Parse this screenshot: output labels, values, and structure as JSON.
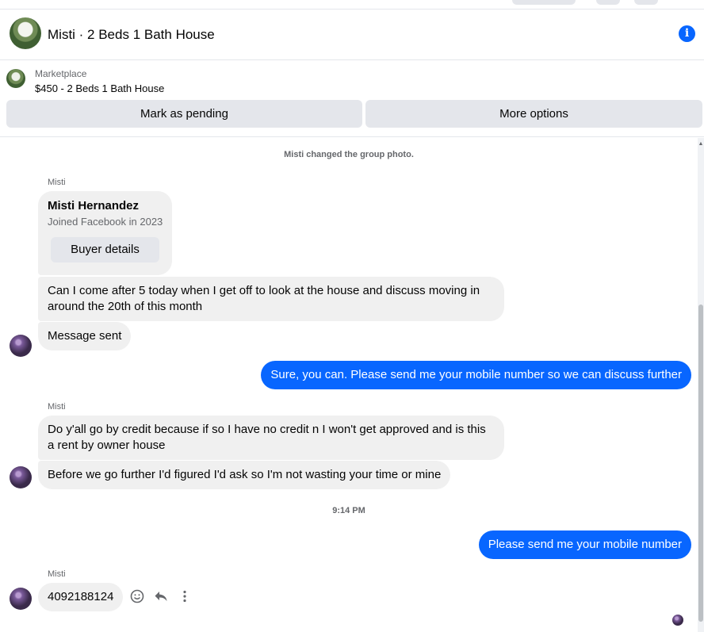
{
  "header": {
    "title": "Misti · 2 Beds 1 Bath House",
    "info_icon": "info-icon"
  },
  "listing": {
    "label": "Marketplace",
    "item": "$450 - 2 Beds 1 Bath House",
    "mark_pending": "Mark as pending",
    "more_options": "More options"
  },
  "chat": {
    "system_message": "Misti changed the group photo.",
    "sender_name": "Misti",
    "card": {
      "name": "Misti Hernandez",
      "subtitle": "Joined Facebook in 2023",
      "button": "Buyer details"
    },
    "messages": [
      {
        "from": "Misti",
        "text": "Can I come after 5 today when I get off to look at the house and discuss moving in around the 20th of this month"
      },
      {
        "from": "Misti",
        "text": "Message sent"
      },
      {
        "from": "me",
        "text": "Sure, you can. Please send me your mobile number so we can discuss further"
      },
      {
        "from": "Misti",
        "text": "Do y'all go by credit because if so I have no credit n I won't get approved and is this a rent by owner house"
      },
      {
        "from": "Misti",
        "text": "Before we go further I'd figured I'd ask so I'm not wasting your time or mine"
      },
      {
        "from": "me",
        "text": "Please send me your mobile number"
      },
      {
        "from": "Misti",
        "text": "4092188124"
      }
    ],
    "timestamp": "9:14 PM"
  },
  "colors": {
    "accent": "#0866ff",
    "incoming_bubble": "#f0f0f0",
    "button_bg": "#e4e6eb",
    "secondary_text": "#65676b"
  }
}
